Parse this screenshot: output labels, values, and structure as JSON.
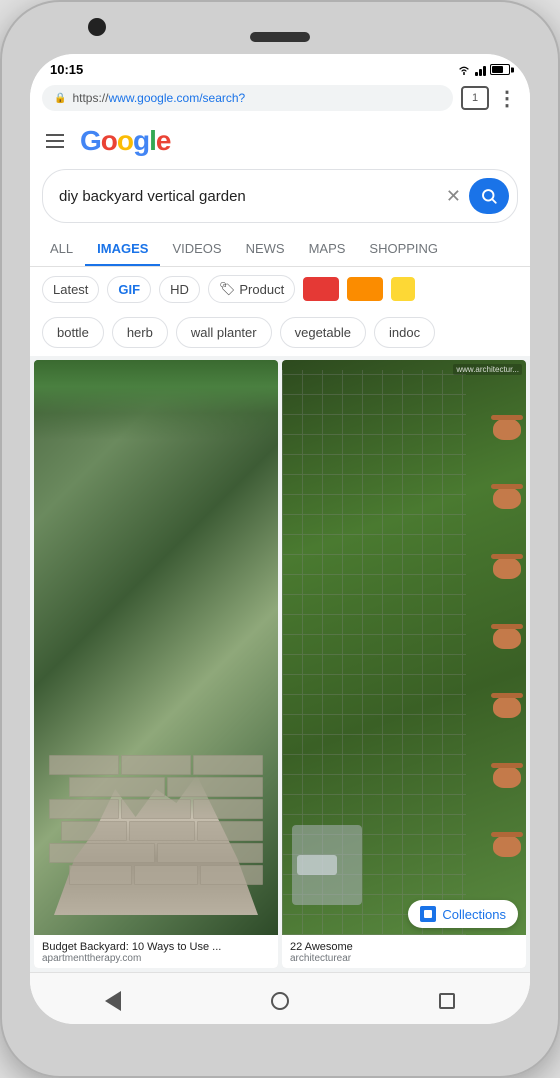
{
  "phone": {
    "time": "10:15",
    "camera": "camera",
    "speaker": "speaker"
  },
  "browser": {
    "url_prefix": "https://",
    "url_domain": "www.google.com",
    "url_path": "/search?",
    "tab_count": "1",
    "more_menu": "⋮"
  },
  "google": {
    "logo_letters": [
      "G",
      "o",
      "o",
      "g",
      "l",
      "e"
    ],
    "hamburger_label": "menu",
    "search_query": "diy backyard vertical garden",
    "search_clear": "✕",
    "search_icon": "🔍"
  },
  "tabs": [
    {
      "label": "ALL",
      "active": false
    },
    {
      "label": "IMAGES",
      "active": true
    },
    {
      "label": "VIDEOS",
      "active": false
    },
    {
      "label": "NEWS",
      "active": false
    },
    {
      "label": "MAPS",
      "active": false
    },
    {
      "label": "SHOPPING",
      "active": false
    }
  ],
  "filters": {
    "latest": "Latest",
    "gif": "GIF",
    "hd": "HD",
    "product_icon": "🏷",
    "product": "Product",
    "color1": "#E53935",
    "color2": "#FB8C00",
    "color3": "#FDD835"
  },
  "chips": [
    "bottle",
    "herb",
    "wall planter",
    "vegetable",
    "indoc"
  ],
  "images": [
    {
      "title": "Budget Backyard: 10 Ways to Use ...",
      "source": "apartmenttherapy.com",
      "alt": "Cinder block vertical garden"
    },
    {
      "title": "22 Awesome",
      "source": "architecturear",
      "alt": "Vertical garden with pots",
      "overlay": "www.architectur..."
    }
  ],
  "collections_btn": "Collections",
  "nav": {
    "back": "back",
    "home": "home",
    "recent": "recent"
  }
}
